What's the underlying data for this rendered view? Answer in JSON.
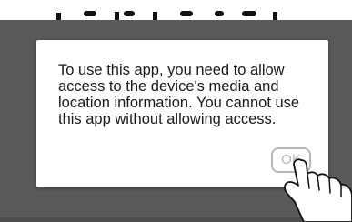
{
  "dialog": {
    "message": "To use this app, you need to allow\naccess to the device's media and\nlocation information. You cannot use\nthis app without allowing access.",
    "ok_label": "OK"
  },
  "icons": {
    "pointer": "tapping-hand-icon"
  },
  "colors": {
    "screen_background": "#5a5a5a",
    "dialog_background": "#ffffff",
    "ok_button_outline": "#b8b8b8",
    "text": "#1a1a1a"
  }
}
